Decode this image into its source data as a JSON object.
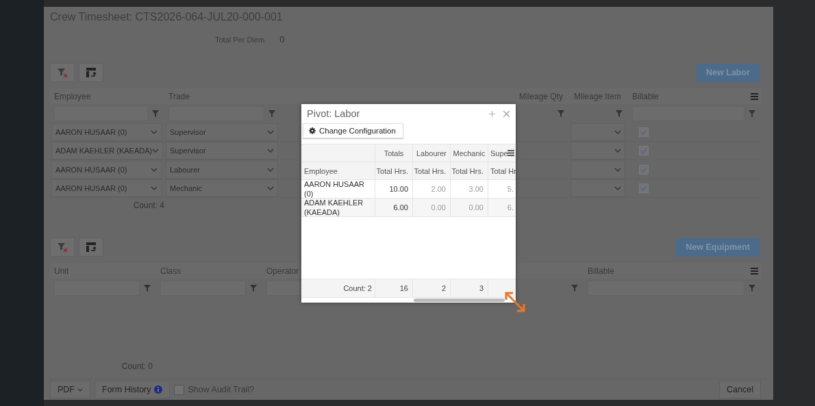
{
  "modal": {
    "title": "Crew Timesheet: CTS2026-064-JUL20-000-001",
    "total_per_diem": {
      "label": "Total Per Diem",
      "value": "0"
    }
  },
  "labor": {
    "new_button": "New Labor",
    "columns": [
      "Employee",
      "Trade",
      "Mileage Qty",
      "Mileage Item",
      "Billable"
    ],
    "rows": [
      {
        "employee": "AARON HUSAAR (0)",
        "trade": "Supervisor",
        "billable": true
      },
      {
        "employee": "ADAM KAEHLER (KAEADA)",
        "trade": "Supervisor",
        "billable": true
      },
      {
        "employee": "AARON HUSAAR (0)",
        "trade": "Labourer",
        "billable": true
      },
      {
        "employee": "AARON HUSAAR (0)",
        "trade": "Mechanic",
        "billable": true
      }
    ],
    "count": "Count: 4"
  },
  "equipment": {
    "new_button": "New Equipment",
    "columns": [
      "Unit",
      "Class",
      "Operator",
      "Billable"
    ],
    "count": "Count: 0"
  },
  "footer": {
    "pdf": "PDF",
    "form_history": "Form History",
    "audit_trail": {
      "label": "Show Audit Trail?",
      "checked": false
    },
    "cancel": "Cancel"
  },
  "pivot": {
    "title": "Pivot: Labor",
    "config_button": "Change Configuration",
    "group_headers": [
      "Totals",
      "Labourer",
      "Mechanic",
      "Supe"
    ],
    "row_header": "Employee",
    "measure_headers": [
      "Total Hrs.",
      "Total Hrs.",
      "Total Hrs.",
      "Total Hr"
    ],
    "rows": [
      {
        "employee": "AARON HUSAAR (0)",
        "values": [
          "10.00",
          "2.00",
          "3.00",
          "5."
        ]
      },
      {
        "employee": "ADAM KAEHLER (KAEADA)",
        "values": [
          "6.00",
          "0.00",
          "0.00",
          "6."
        ]
      }
    ],
    "footer": {
      "label": "Count: 2",
      "values": [
        "16",
        "2",
        "3"
      ]
    }
  }
}
